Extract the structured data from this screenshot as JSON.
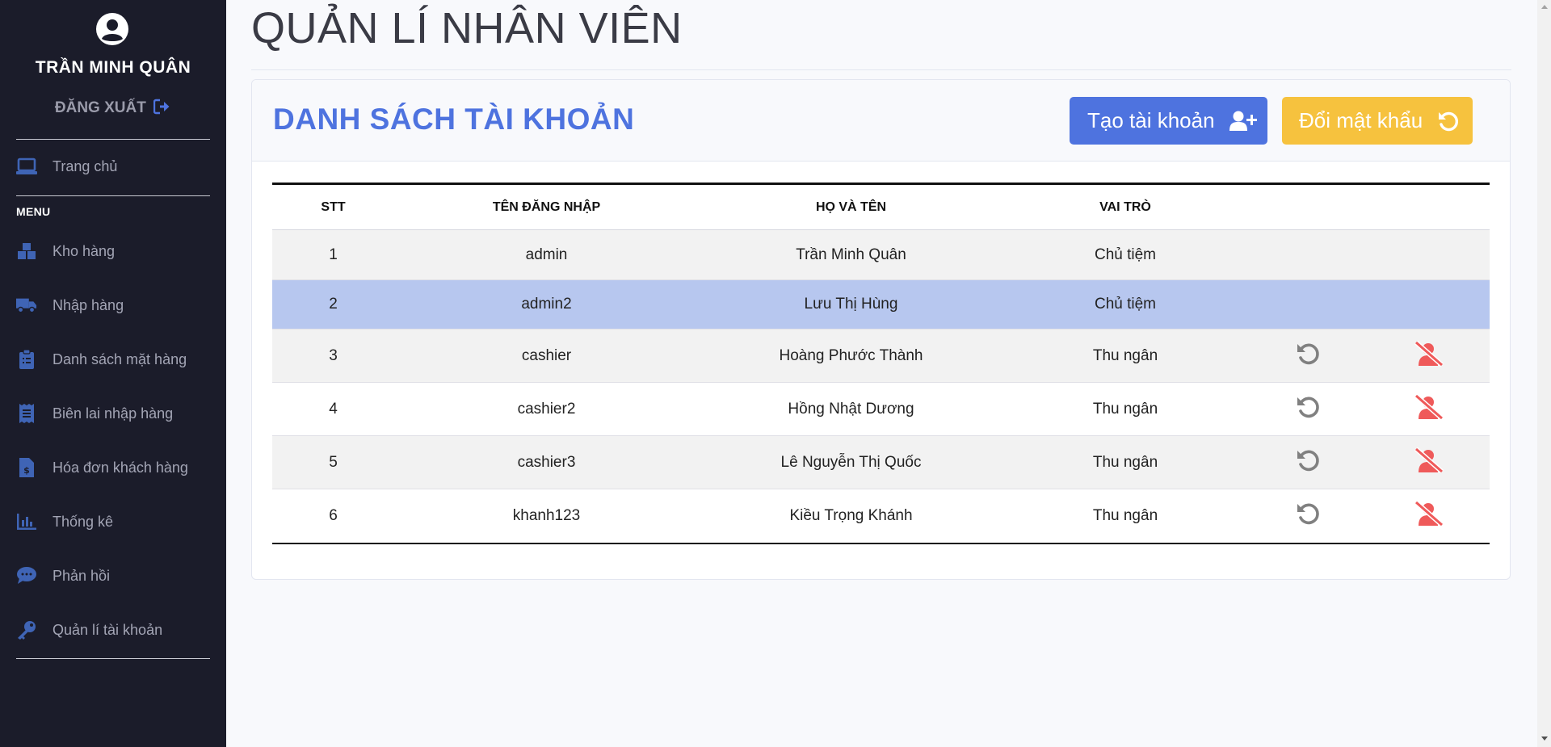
{
  "sidebar": {
    "user_name": "TRẦN MINH QUÂN",
    "logout_label": "ĐĂNG XUẤT",
    "home_label": "Trang chủ",
    "menu_heading": "MENU",
    "items": [
      {
        "label": "Kho hàng",
        "icon": "boxes-icon"
      },
      {
        "label": "Nhập hàng",
        "icon": "truck-icon"
      },
      {
        "label": "Danh sách mặt hàng",
        "icon": "clipboard-list-icon"
      },
      {
        "label": "Biên lai nhập hàng",
        "icon": "receipt-icon"
      },
      {
        "label": "Hóa đơn khách hàng",
        "icon": "file-invoice-dollar-icon"
      },
      {
        "label": "Thống kê",
        "icon": "bar-chart-icon"
      },
      {
        "label": "Phản hồi",
        "icon": "comment-icon"
      },
      {
        "label": "Quản lí tài khoản",
        "icon": "key-icon"
      }
    ]
  },
  "page": {
    "title": "QUẢN LÍ NHÂN VIÊN"
  },
  "card": {
    "title": "DANH SÁCH TÀI KHOẢN",
    "create_button": "Tạo tài khoản",
    "change_password_button": "Đổi mật khẩu"
  },
  "table": {
    "headers": [
      "STT",
      "TÊN ĐĂNG NHẬP",
      "HỌ VÀ TÊN",
      "VAI TRÒ"
    ],
    "rows": [
      {
        "stt": "1",
        "username": "admin",
        "fullname": "Trần Minh Quân",
        "role": "Chủ tiệm"
      },
      {
        "stt": "2",
        "username": "admin2",
        "fullname": "Lưu Thị Hùng",
        "role": "Chủ tiệm"
      },
      {
        "stt": "3",
        "username": "cashier",
        "fullname": "Hoàng Phước Thành",
        "role": "Thu ngân"
      },
      {
        "stt": "4",
        "username": "cashier2",
        "fullname": "Hồng Nhật Dương",
        "role": "Thu ngân"
      },
      {
        "stt": "5",
        "username": "cashier3",
        "fullname": "Lê Nguyễn Thị Quốc",
        "role": "Thu ngân"
      },
      {
        "stt": "6",
        "username": "khanh123",
        "fullname": "Kiều Trọng Khánh",
        "role": "Thu ngân"
      }
    ]
  },
  "colors": {
    "sidebar_bg": "#1b1c2a",
    "primary": "#4e73df",
    "warning": "#f6c23e",
    "danger_icon": "#e74a3b",
    "selected_row": "#b7c7ef"
  }
}
